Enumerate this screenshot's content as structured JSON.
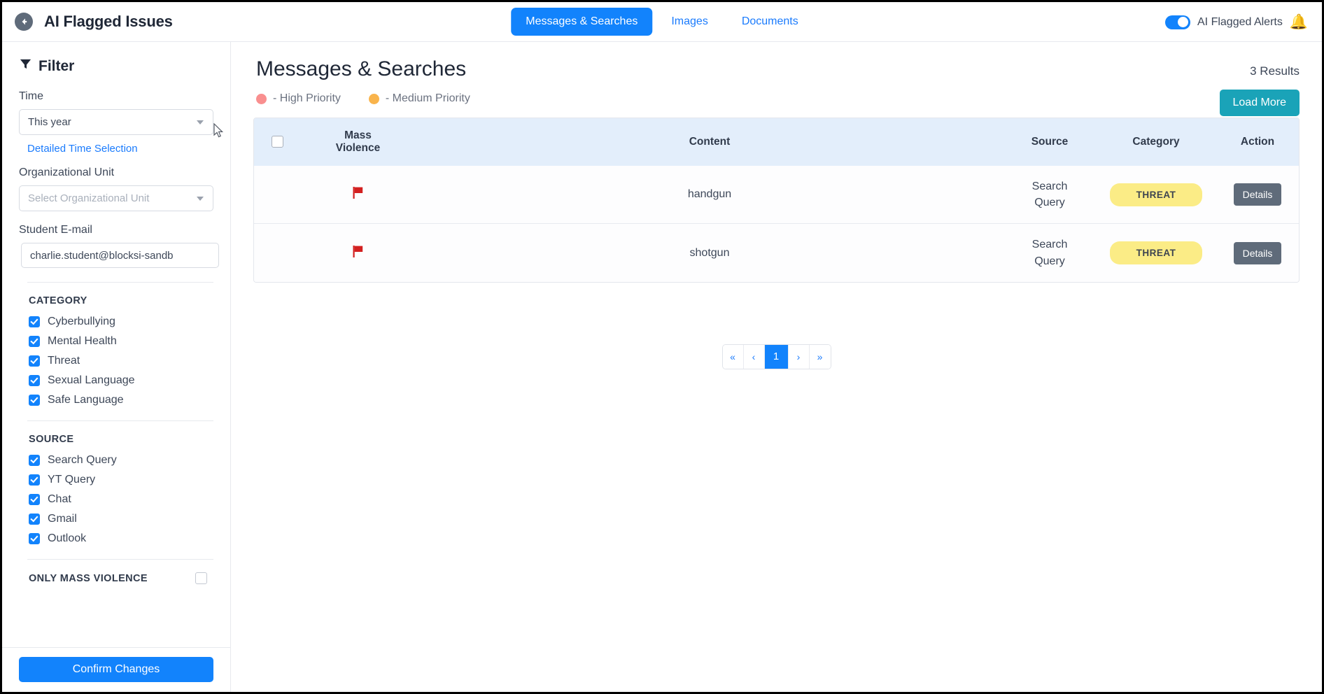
{
  "header": {
    "back_icon": "back-arrow-icon",
    "title": "AI Flagged Issues",
    "tabs": [
      {
        "label": "Messages & Searches",
        "active": true
      },
      {
        "label": "Images",
        "active": false
      },
      {
        "label": "Documents",
        "active": false
      }
    ],
    "alerts_toggle": {
      "label": "AI Flagged Alerts",
      "on": true
    },
    "bell_icon": "bell-icon",
    "accent_color": "#1283fc"
  },
  "sidebar": {
    "filter_icon": "funnel-icon",
    "filter_title": "Filter",
    "time_label": "Time",
    "time_value": "This year",
    "detailed_time_link": "Detailed Time Selection",
    "org_unit_label": "Organizational Unit",
    "org_unit_placeholder": "Select Organizational Unit",
    "org_unit_value": "",
    "student_email_label": "Student E-mail",
    "student_email_value": "charlie.student@blocksi-sandb",
    "student_email_placeholder": "Student E-mail",
    "category_title": "CATEGORY",
    "categories": [
      {
        "label": "Cyberbullying",
        "checked": true
      },
      {
        "label": "Mental Health",
        "checked": true
      },
      {
        "label": "Threat",
        "checked": true
      },
      {
        "label": "Sexual Language",
        "checked": true
      },
      {
        "label": "Safe Language",
        "checked": true
      }
    ],
    "source_title": "SOURCE",
    "sources": [
      {
        "label": "Search Query",
        "checked": true
      },
      {
        "label": "YT Query",
        "checked": true
      },
      {
        "label": "Chat",
        "checked": true
      },
      {
        "label": "Gmail",
        "checked": true
      },
      {
        "label": "Outlook",
        "checked": true
      }
    ],
    "only_mass_violence_title": "ONLY MASS VIOLENCE",
    "only_mass_violence_checked": false,
    "confirm_label": "Confirm Changes"
  },
  "main": {
    "page_title": "Messages & Searches",
    "results_count": "3 Results",
    "load_more_label": "Load More",
    "legend": [
      {
        "label": "- High Priority",
        "color": "#f98f8f"
      },
      {
        "label": "- Medium Priority",
        "color": "#f9b44c"
      }
    ],
    "table": {
      "columns": [
        "",
        "Mass Violence",
        "Content",
        "Source",
        "Category",
        "Action"
      ],
      "mass_violence_header_line1": "Mass",
      "mass_violence_header_line2": "Violence",
      "content_header": "Content",
      "source_header": "Source",
      "category_header": "Category",
      "action_header": "Action",
      "rows": [
        {
          "flag": "red-flag-icon",
          "content": "handgun",
          "source_line1": "Search",
          "source_line2": "Query",
          "category": "THREAT",
          "category_color": "#fbec86",
          "action": "Details"
        },
        {
          "flag": "red-flag-icon",
          "content": "shotgun",
          "source_line1": "Search",
          "source_line2": "Query",
          "category": "THREAT",
          "category_color": "#fbec86",
          "action": "Details"
        }
      ]
    },
    "pagination": {
      "first": "«",
      "prev": "‹",
      "current": "1",
      "next": "›",
      "last": "»"
    }
  }
}
